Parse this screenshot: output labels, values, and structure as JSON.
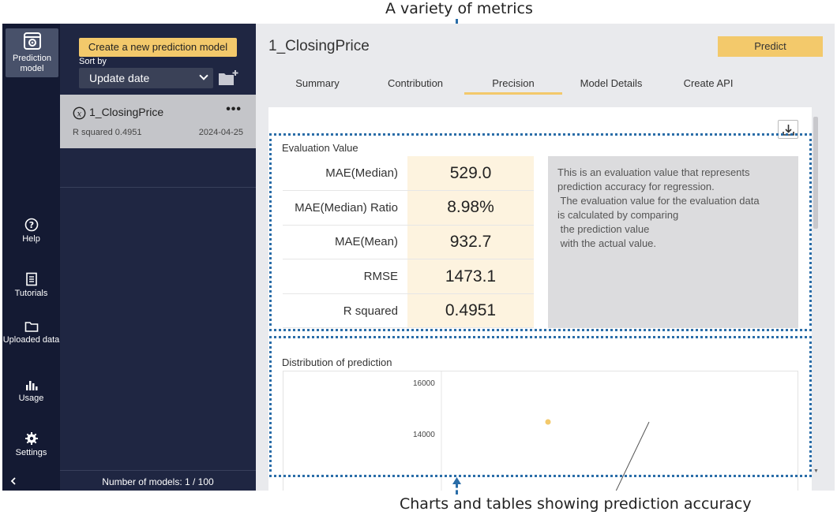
{
  "annotations": {
    "top": "A variety of metrics",
    "bottom": "Charts and tables showing prediction accuracy"
  },
  "rail": {
    "items": [
      {
        "label": "Prediction model",
        "icon": "gear-cube-icon",
        "active": true
      },
      {
        "label": "Help",
        "icon": "help-circle-icon"
      },
      {
        "label": "Tutorials",
        "icon": "document-icon"
      },
      {
        "label": "Uploaded data",
        "icon": "folder-icon"
      },
      {
        "label": "Usage",
        "icon": "bar-chart-icon"
      },
      {
        "label": "Settings",
        "icon": "gear-icon"
      }
    ],
    "collapse_icon": "chevron-left-icon"
  },
  "list": {
    "create_label": "Create a new prediction model",
    "sort_label": "Sort by",
    "sort_value": "Update date",
    "models": [
      {
        "name": "1_ClosingPrice",
        "metric": "R squared 0.4951",
        "date": "2024-04-25"
      }
    ],
    "footer": "Number of models: 1 / 100"
  },
  "main": {
    "title": "1_ClosingPrice",
    "predict_label": "Predict",
    "tabs": [
      {
        "label": "Summary",
        "active": false
      },
      {
        "label": "Contribution",
        "active": false
      },
      {
        "label": "Precision",
        "active": true
      },
      {
        "label": "Model Details",
        "active": false
      },
      {
        "label": "Create API",
        "active": false
      }
    ],
    "evaluation": {
      "title": "Evaluation Value",
      "rows": [
        {
          "label": "MAE(Median)",
          "value": "529.0"
        },
        {
          "label": "MAE(Median) Ratio",
          "value": "8.98%"
        },
        {
          "label": "MAE(Mean)",
          "value": "932.7"
        },
        {
          "label": "RMSE",
          "value": "1473.1"
        },
        {
          "label": "R squared",
          "value": "0.4951"
        }
      ],
      "description": [
        "This is an evaluation value that represents",
        "prediction accuracy for regression.",
        " The evaluation value for the evaluation data",
        "is calculated by comparing",
        " the prediction value",
        " with the actual value."
      ]
    },
    "distribution": {
      "title": "Distribution of prediction",
      "y_ticks": [
        "16000",
        "14000"
      ]
    }
  },
  "colors": {
    "accent": "#f3c96b",
    "rail_bg": "#141a33",
    "panel_bg": "#1f2642",
    "annotation": "#2a6da8"
  }
}
